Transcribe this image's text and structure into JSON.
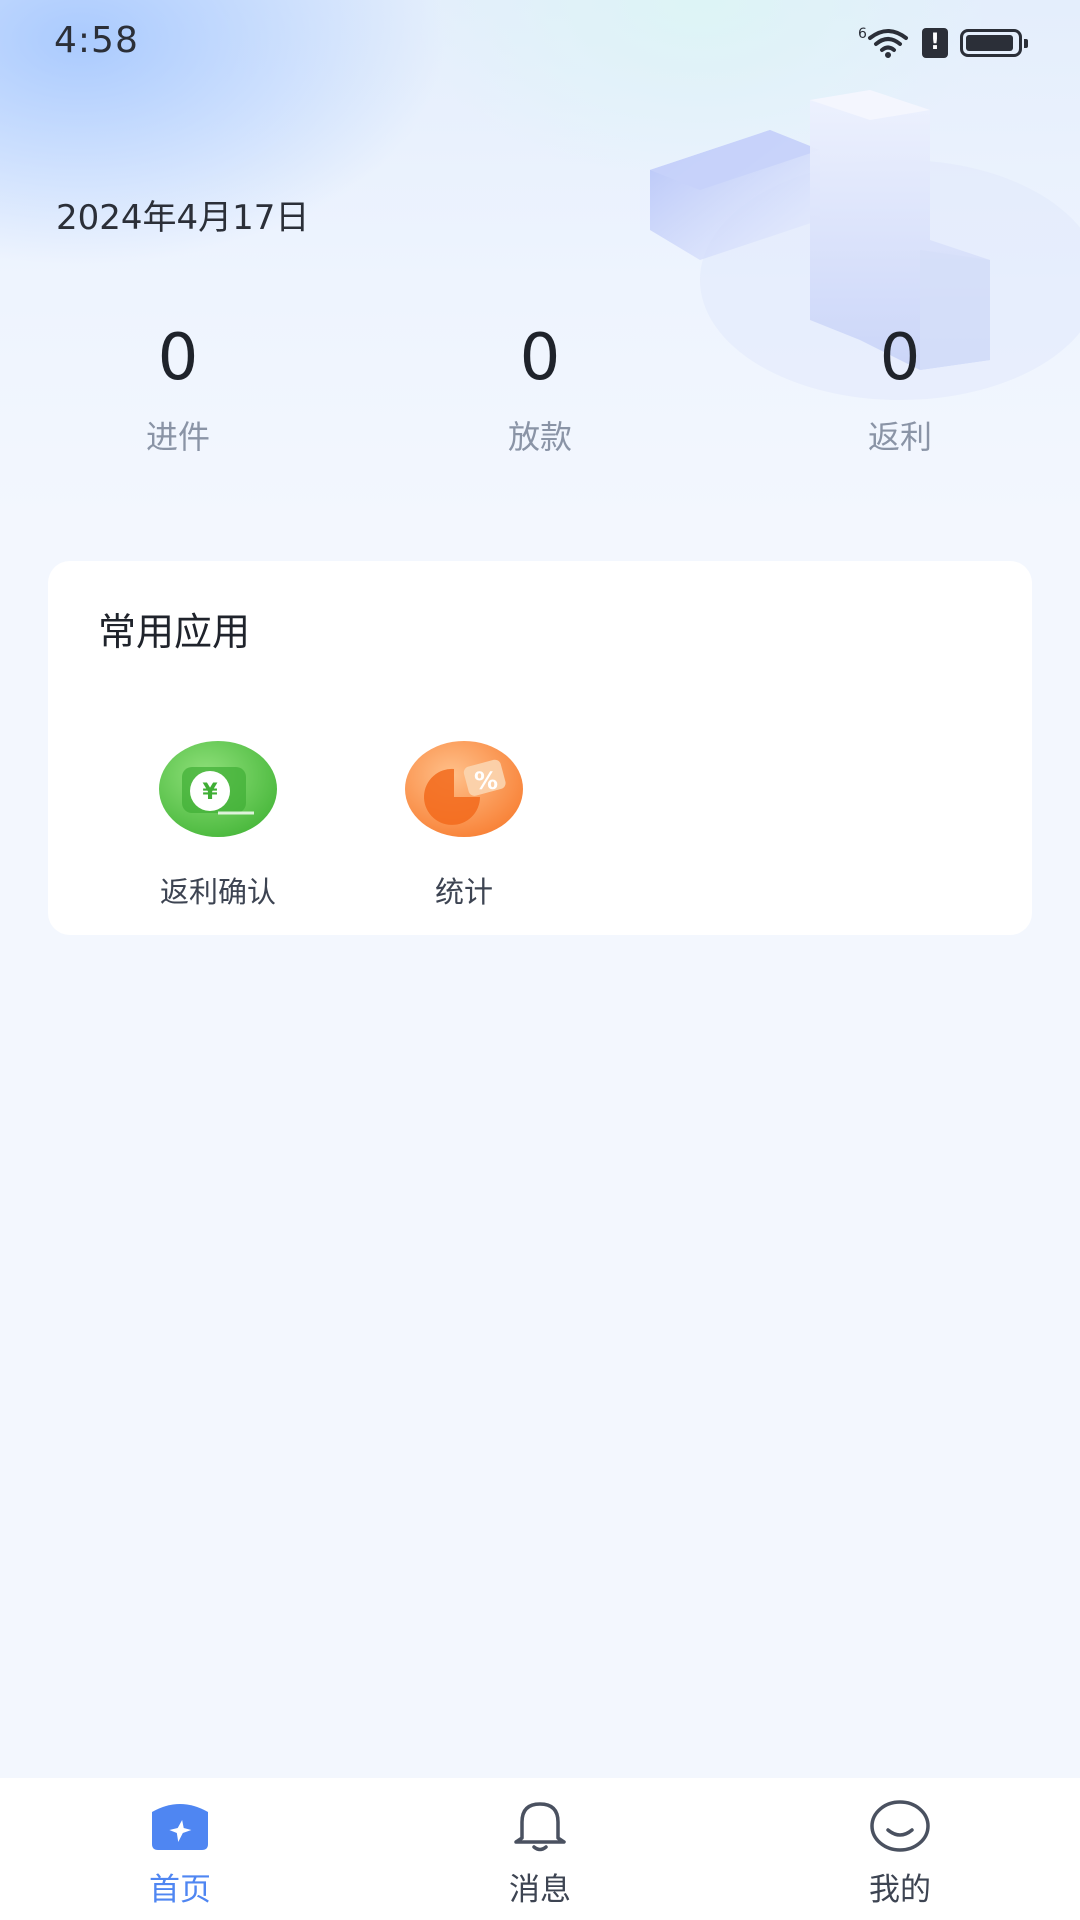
{
  "status_bar": {
    "time": "4:58",
    "signal_label": "6",
    "alert_glyph": "!",
    "battery_level": 0.95
  },
  "header": {
    "date": "2024年4月17日",
    "stats": [
      {
        "value": "0",
        "label": "进件"
      },
      {
        "value": "0",
        "label": "放款"
      },
      {
        "value": "0",
        "label": "返利"
      }
    ]
  },
  "apps_card": {
    "title": "常用应用",
    "apps": [
      {
        "label": "返利确认",
        "icon": "rebate-confirm-icon",
        "color": "#5bc84a"
      },
      {
        "label": "统计",
        "icon": "statistics-icon",
        "color": "#f7893c"
      }
    ]
  },
  "tab_bar": {
    "tabs": [
      {
        "label": "首页",
        "icon": "home-icon",
        "active": true
      },
      {
        "label": "消息",
        "icon": "bell-icon",
        "active": false
      },
      {
        "label": "我的",
        "icon": "smile-icon",
        "active": false
      }
    ],
    "accent_color": "#4f86f2"
  }
}
